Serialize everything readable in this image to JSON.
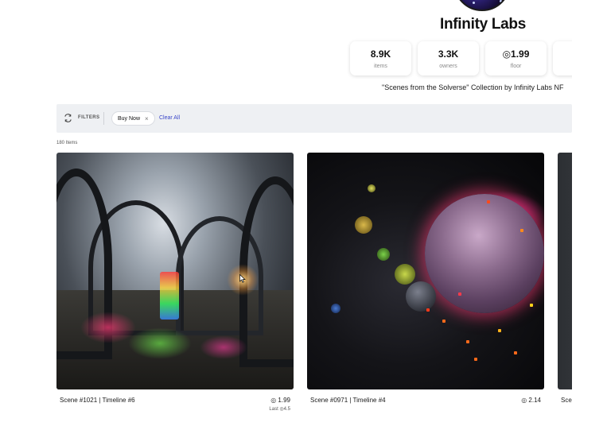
{
  "collection": {
    "name": "Infinity Labs",
    "description": "\"Scenes from the Solverse\" Collection by Infinity Labs NF"
  },
  "stats": [
    {
      "value": "8.9K",
      "label": "items"
    },
    {
      "value": "3.3K",
      "label": "owners"
    },
    {
      "value": "◎1.99",
      "label": "floor"
    },
    {
      "value": "◎",
      "label": ""
    }
  ],
  "filters": {
    "label": "FILTERS",
    "chip": "Buy Now",
    "chip_remove": "×",
    "clear_all": "Clear All",
    "icon": "refresh-icon"
  },
  "item_count": "180 Items",
  "cards": [
    {
      "title": "Scene #1021 | Timeline #6",
      "currency": "◎",
      "price": "1.99",
      "last": "Last ◎4.5"
    },
    {
      "title": "Scene #0971 | Timeline #4",
      "currency": "◎",
      "price": "2.14",
      "last": ""
    },
    {
      "title": "Sce",
      "currency": "",
      "price": "",
      "last": ""
    }
  ]
}
